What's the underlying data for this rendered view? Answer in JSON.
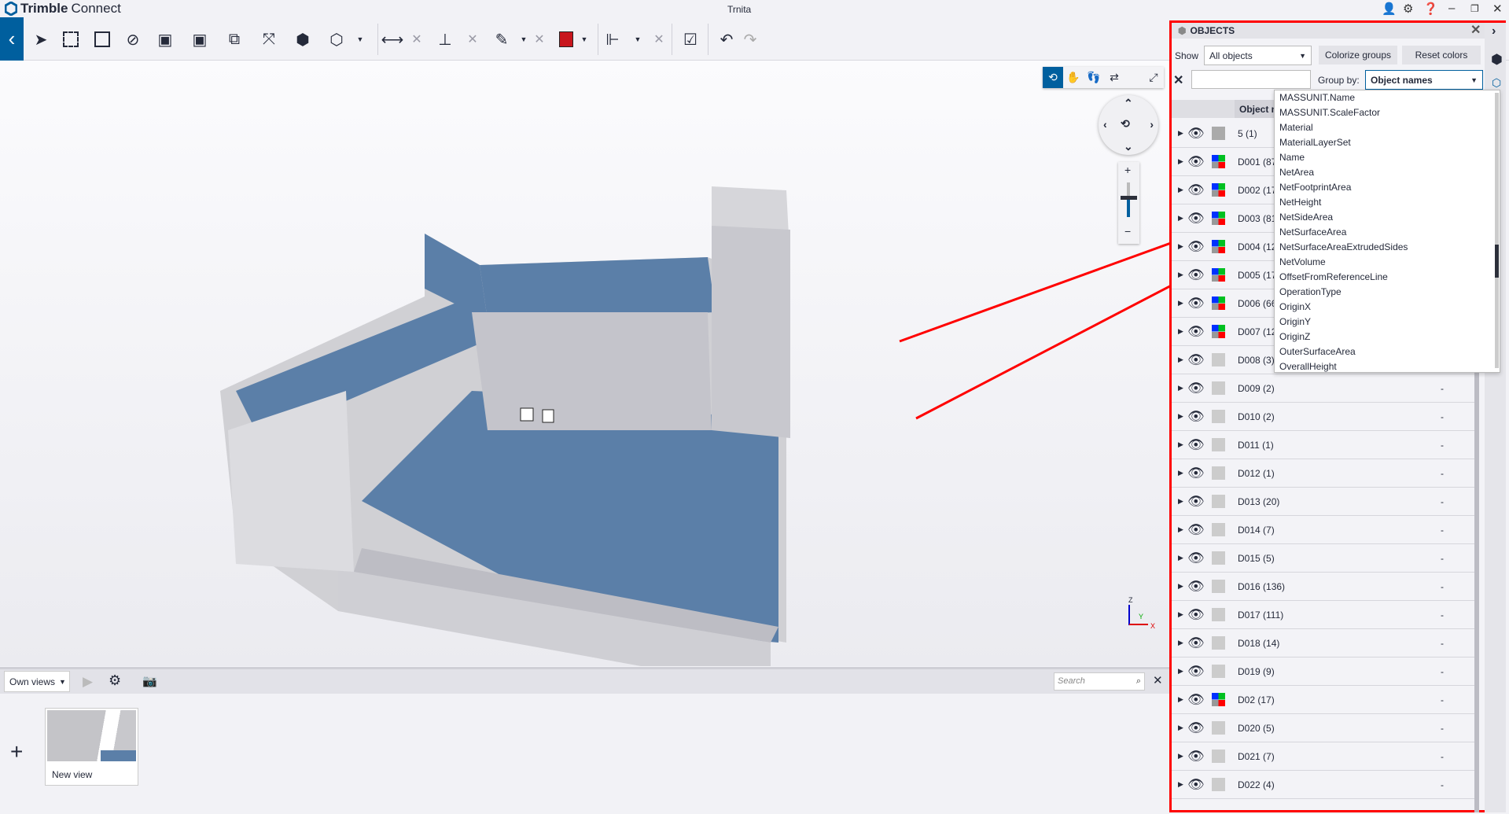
{
  "app": {
    "brand_bold": "Trimble",
    "brand_light": "Connect",
    "window_title": "Trnita"
  },
  "viewer": {
    "axis_z": "Z",
    "axis_y": "Y",
    "axis_x": "X"
  },
  "views": {
    "dropdown_label": "Own views",
    "search_placeholder": "Search",
    "new_view_label": "New view",
    "add_label": "+"
  },
  "objects": {
    "title": "OBJECTS",
    "show_label": "Show",
    "show_value": "All objects",
    "colorize_label": "Colorize groups",
    "reset_label": "Reset colors",
    "search_value": "",
    "groupby_label": "Group by:",
    "groupby_value": "Object names",
    "column_header": "Object n",
    "rows": [
      {
        "name": "5 (1)",
        "swatch": "dark",
        "value": ""
      },
      {
        "name": "D001 (87",
        "swatch": "multi",
        "value": ""
      },
      {
        "name": "D002 (17",
        "swatch": "multi",
        "value": ""
      },
      {
        "name": "D003 (81",
        "swatch": "multi",
        "value": ""
      },
      {
        "name": "D004 (12",
        "swatch": "multi",
        "value": ""
      },
      {
        "name": "D005 (17",
        "swatch": "multi",
        "value": ""
      },
      {
        "name": "D006 (66",
        "swatch": "multi",
        "value": ""
      },
      {
        "name": "D007 (12",
        "swatch": "multi",
        "value": ""
      },
      {
        "name": "D008 (3)",
        "swatch": "gray",
        "value": ""
      },
      {
        "name": "D009 (2)",
        "swatch": "gray",
        "value": "-"
      },
      {
        "name": "D010 (2)",
        "swatch": "gray",
        "value": "-"
      },
      {
        "name": "D011 (1)",
        "swatch": "gray",
        "value": "-"
      },
      {
        "name": "D012 (1)",
        "swatch": "gray",
        "value": "-"
      },
      {
        "name": "D013 (20)",
        "swatch": "gray",
        "value": "-"
      },
      {
        "name": "D014 (7)",
        "swatch": "gray",
        "value": "-"
      },
      {
        "name": "D015 (5)",
        "swatch": "gray",
        "value": "-"
      },
      {
        "name": "D016 (136)",
        "swatch": "gray",
        "value": "-"
      },
      {
        "name": "D017 (111)",
        "swatch": "gray",
        "value": "-"
      },
      {
        "name": "D018 (14)",
        "swatch": "gray",
        "value": "-"
      },
      {
        "name": "D019 (9)",
        "swatch": "gray",
        "value": "-"
      },
      {
        "name": "D02 (17)",
        "swatch": "multi",
        "value": "-"
      },
      {
        "name": "D020 (5)",
        "swatch": "gray",
        "value": "-"
      },
      {
        "name": "D021 (7)",
        "swatch": "gray",
        "value": "-"
      },
      {
        "name": "D022 (4)",
        "swatch": "gray",
        "value": "-"
      }
    ],
    "groupby_options": [
      "MASSUNIT.Name",
      "MASSUNIT.ScaleFactor",
      "Material",
      "MaterialLayerSet",
      "Name",
      "NetArea",
      "NetFootprintArea",
      "NetHeight",
      "NetSideArea",
      "NetSurfaceArea",
      "NetSurfaceAreaExtrudedSides",
      "NetVolume",
      "OffsetFromReferenceLine",
      "OperationType",
      "OriginX",
      "OriginY",
      "OriginZ",
      "OuterSurfaceArea",
      "OverallHeight"
    ]
  },
  "colors": {
    "accent": "#005f9e",
    "annotation": "#ff0000",
    "model_blue": "#5b7fa8",
    "model_gray": "#d2d2d2"
  }
}
